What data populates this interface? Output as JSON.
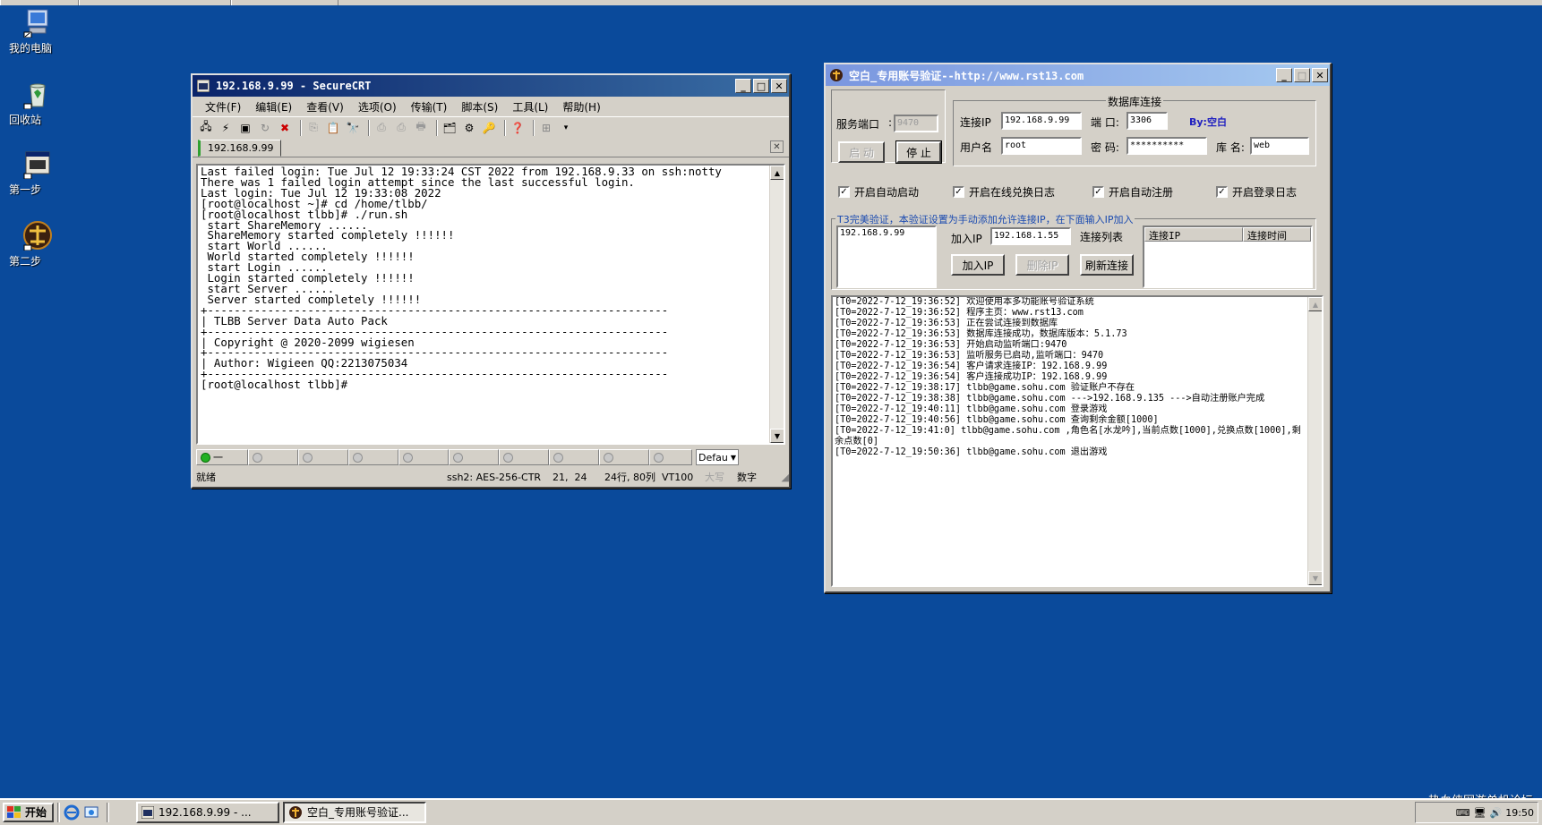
{
  "desktop": {
    "icons": [
      {
        "label": "我的电脑",
        "icon": "my-computer-icon"
      },
      {
        "label": "回收站",
        "icon": "recycle-bin-icon"
      },
      {
        "label": "第一步",
        "icon": "step-one-icon"
      },
      {
        "label": "第二步",
        "icon": "step-two-icon"
      }
    ]
  },
  "securecrt": {
    "title": "192.168.9.99 - SecureCRT",
    "menu": [
      "文件(F)",
      "编辑(E)",
      "查看(V)",
      "选项(O)",
      "传输(T)",
      "脚本(S)",
      "工具(L)",
      "帮助(H)"
    ],
    "session_tab": "192.168.9.99",
    "terminal_lines": [
      "Last failed login: Tue Jul 12 19:33:24 CST 2022 from 192.168.9.33 on ssh:notty",
      "There was 1 failed login attempt since the last successful login.",
      "Last login: Tue Jul 12 19:33:08 2022",
      "[root@localhost ~]# cd /home/tlbb/",
      "[root@localhost tlbb]# ./run.sh",
      " start ShareMemory ......",
      " ShareMemory started completely !!!!!!",
      " start World ......",
      " World started completely !!!!!!",
      " start Login ......",
      " Login started completely !!!!!!",
      " start Server ......",
      " Server started completely !!!!!!",
      "+---------------------------------------------------------------------",
      "| TLBB Server Data Auto Pack",
      "+---------------------------------------------------------------------",
      "| Copyright @ 2020-2099 wigiesen",
      "+---------------------------------------------------------------------",
      "| Author: Wigieen QQ:2213075034",
      "+---------------------------------------------------------------------",
      "[root@localhost tlbb]#"
    ],
    "quick_button_first": "一",
    "quick_select": "Defau",
    "status": {
      "ready": "就绪",
      "cipher": "ssh2: AES-256-CTR",
      "cursor": "21,  24",
      "size": "24行, 80列",
      "term": "VT100",
      "caps": "大写",
      "num": "数字"
    }
  },
  "verifier": {
    "title": "空白_专用账号验证--http://www.rst13.com",
    "service_port_label": "服务端口",
    "service_port_value": "9470",
    "start_button": "启 动",
    "stop_button": "停 止",
    "db_group_label": "数据库连接",
    "conn_ip_label": "连接IP",
    "conn_ip_value": "192.168.9.99",
    "port_label": "端 口:",
    "port_value": "3306",
    "by_label": "By:空白",
    "user_label": "用户名",
    "user_value": "root",
    "pwd_label": "密 码:",
    "pwd_value": "**********",
    "db_name_label": "库 名:",
    "db_name_value": "web",
    "checkboxes": [
      "开启自动启动",
      "开启在线兑换日志",
      "开启自动注册",
      "开启登录日志"
    ],
    "t3_group_label": "T3完美验证，本验证设置为手动添加允许连接IP，在下面输入IP加入",
    "allowed_ips": [
      "192.168.9.99"
    ],
    "add_ip_label": "加入IP",
    "add_ip_value": "192.168.1.55",
    "conn_list_label": "连接列表",
    "add_ip_button": "加入IP",
    "delete_ip_button": "删除IP",
    "refresh_button": "刷新连接",
    "conn_list_headers": [
      "连接IP",
      "连接时间"
    ],
    "log_lines": [
      "[T0=2022-7-12_19:36:52] 欢迎使用本多功能账号验证系统",
      "[T0=2022-7-12_19:36:52] 程序主页：www.rst13.com",
      "[T0=2022-7-12_19:36:53] 正在尝试连接到数据库",
      "[T0=2022-7-12_19:36:53] 数据库连接成功，数据库版本：5.1.73",
      "[T0=2022-7-12_19:36:53] 开始启动监听端口:9470",
      "[T0=2022-7-12_19:36:53] 监听服务已启动,监听端口：9470",
      "[T0=2022-7-12_19:36:54] 客户请求连接IP：192.168.9.99",
      "[T0=2022-7-12_19:36:54] 客户连接成功IP：192.168.9.99",
      "[T0=2022-7-12_19:38:17] tlbb@game.sohu.com 验证账户不存在",
      "[T0=2022-7-12_19:38:38] tlbb@game.sohu.com --->192.168.9.135 --->自动注册账户完成",
      "[T0=2022-7-12_19:40:11] tlbb@game.sohu.com 登录游戏",
      "[T0=2022-7-12_19:40:56] tlbb@game.sohu.com 查询剩余金额[1000]",
      "[T0=2022-7-12_19:41:0] tlbb@game.sohu.com ,角色名[水龙吟],当前点数[1000],兑换点数[1000],剩余点数[0]",
      "[T0=2022-7-12_19:50:36] tlbb@game.sohu.com 退出游戏"
    ]
  },
  "taskbar": {
    "start": "开始",
    "tasks": [
      "192.168.9.99 - ...",
      "空白_专用账号验证..."
    ],
    "clock": "19:50"
  },
  "watermark": "热血侠网游单机论坛"
}
